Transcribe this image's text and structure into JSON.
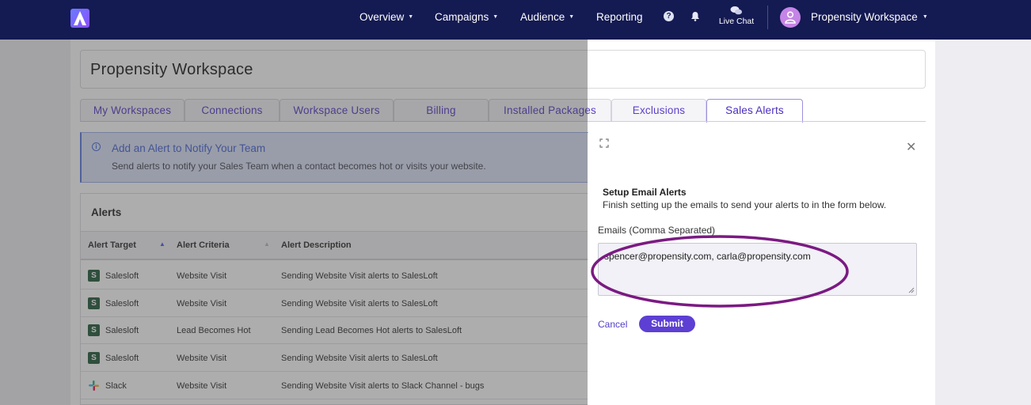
{
  "nav": {
    "items": [
      {
        "label": "Overview"
      },
      {
        "label": "Campaigns"
      },
      {
        "label": "Audience"
      },
      {
        "label": "Reporting"
      }
    ],
    "help_icon": "question-circle-icon",
    "bell_icon": "bell-icon",
    "live_chat_label": "Live Chat",
    "workspace_name": "Propensity Workspace"
  },
  "page": {
    "title": "Propensity Workspace",
    "tabs": [
      {
        "label": "My Workspaces"
      },
      {
        "label": "Connections"
      },
      {
        "label": "Workspace Users"
      },
      {
        "label": "Billing"
      },
      {
        "label": "Installed Packages"
      },
      {
        "label": "Exclusions"
      },
      {
        "label": "Sales Alerts",
        "active": true
      }
    ]
  },
  "notice": {
    "title": "Add an Alert to Notify Your Team",
    "description": "Send alerts to notify your Sales Team when a contact becomes hot or visits your website."
  },
  "alerts": {
    "title": "Alerts",
    "columns": [
      "Alert Target",
      "Alert Criteria",
      "Alert Description"
    ],
    "rows": [
      {
        "target": "Salesloft",
        "criteria": "Website Visit",
        "description": "Sending Website Visit alerts to SalesLoft",
        "icon": "salesloft-icon"
      },
      {
        "target": "Salesloft",
        "criteria": "Website Visit",
        "description": "Sending Website Visit alerts to SalesLoft",
        "icon": "salesloft-icon"
      },
      {
        "target": "Salesloft",
        "criteria": "Lead Becomes Hot",
        "description": "Sending Lead Becomes Hot alerts to SalesLoft",
        "icon": "salesloft-icon"
      },
      {
        "target": "Salesloft",
        "criteria": "Website Visit",
        "description": "Sending Website Visit alerts to SalesLoft",
        "icon": "salesloft-icon"
      },
      {
        "target": "Slack",
        "criteria": "Website Visit",
        "description": "Sending Website Visit alerts to Slack Channel - bugs",
        "icon": "slack-icon"
      }
    ]
  },
  "panel": {
    "setup_title": "Setup Email Alerts",
    "setup_description": "Finish setting up the emails to send your alerts to in the form below.",
    "emails_label": "Emails (Comma Separated)",
    "emails_value": "spencer@propensity.com, carla@propensity.com",
    "cancel_label": "Cancel",
    "submit_label": "Submit"
  },
  "colors": {
    "nav_bg": "#141a52",
    "accent": "#5d3fd3",
    "highlight_circle": "#7b1a82"
  }
}
